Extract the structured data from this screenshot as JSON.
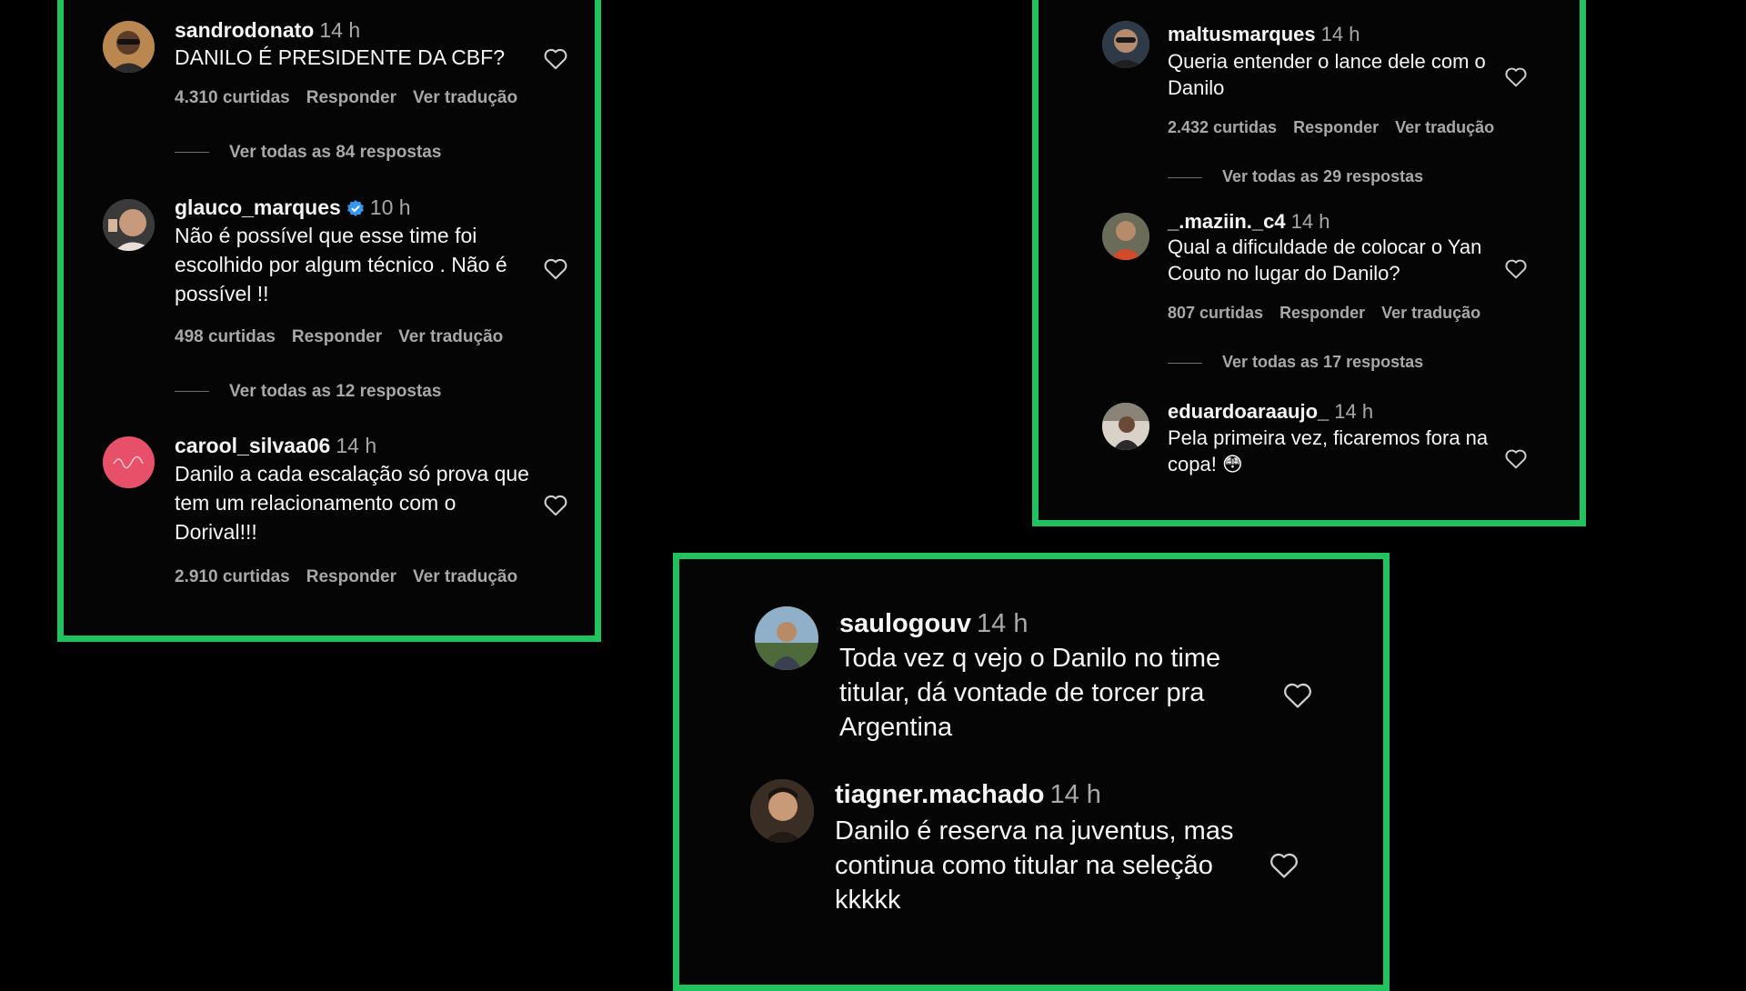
{
  "panel_left": {
    "comments": [
      {
        "username": "sandrodonato",
        "time": "14 h",
        "text": "DANILO É PRESIDENTE DA CBF?",
        "likes": "4.310 curtidas",
        "reply_label": "Responder",
        "translate_label": "Ver tradução",
        "view_replies": "Ver todas as 84 respostas"
      },
      {
        "username": "glauco_marques",
        "verified": true,
        "time": "10 h",
        "text": "Não é possível que esse time foi escolhido por algum técnico . Não é possível !!",
        "likes": "498 curtidas",
        "reply_label": "Responder",
        "translate_label": "Ver tradução",
        "view_replies": "Ver todas as 12 respostas"
      },
      {
        "username": "carool_silvaa06",
        "time": "14 h",
        "text": "Danilo a cada escalação só prova que tem um relacionamento com o Dorival!!!",
        "likes": "2.910 curtidas",
        "reply_label": "Responder",
        "translate_label": "Ver tradução"
      }
    ]
  },
  "panel_right": {
    "comments": [
      {
        "username": "maltusmarques",
        "time": "14 h",
        "text": "Queria entender o lance dele com o Danilo",
        "likes": "2.432 curtidas",
        "reply_label": "Responder",
        "translate_label": "Ver tradução",
        "view_replies": "Ver todas as 29 respostas"
      },
      {
        "username": "_.maziin._c4",
        "time": "14 h",
        "text": "Qual a dificuldade de colocar o Yan Couto no lugar do Danilo?",
        "likes": "807 curtidas",
        "reply_label": "Responder",
        "translate_label": "Ver tradução",
        "view_replies": "Ver todas as 17 respostas"
      },
      {
        "username": "eduardoaraaujo_",
        "time": "14 h",
        "text": "Pela primeira vez, ficaremos fora na copa! 😳"
      }
    ]
  },
  "panel_bottom": {
    "comments": [
      {
        "username": "saulogouv",
        "time": "14 h",
        "text": "Toda vez q vejo o Danilo no time titular, dá vontade de torcer pra Argentina"
      },
      {
        "username": "tiagner.machado",
        "time": "14 h",
        "text": "Danilo é reserva na juventus, mas continua como titular na seleção kkkkk"
      }
    ]
  },
  "colors": {
    "accent_border": "#21c25e",
    "verified_badge": "#3897f0",
    "muted_text": "#a8a8a8"
  },
  "icons": [
    "heart-icon",
    "verified-badge-icon"
  ]
}
